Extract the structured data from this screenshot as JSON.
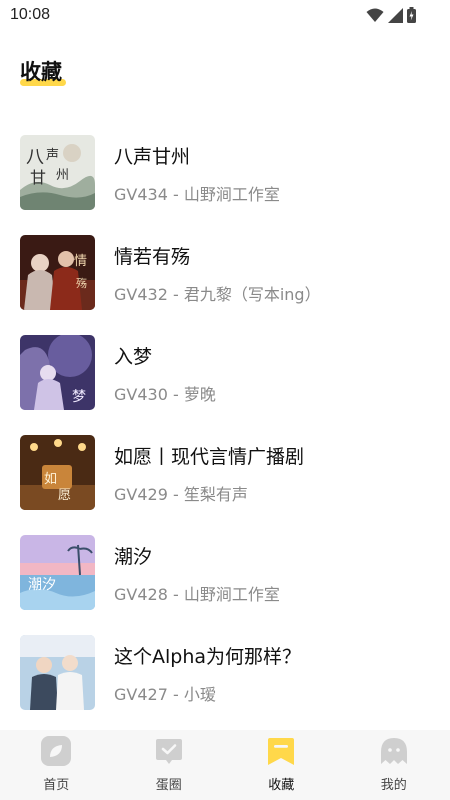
{
  "status_bar": {
    "time": "10:08"
  },
  "page_title": "收藏",
  "favorites": [
    {
      "title": "八声甘州",
      "subtitle": "GV434 - 山野涧工作室",
      "cover_icon": "cover-bashengganzhou"
    },
    {
      "title": "情若有殇",
      "subtitle": "GV432 - 君九黎（写本ing）",
      "cover_icon": "cover-qingruoyoushang"
    },
    {
      "title": "入梦",
      "subtitle": "GV430 - 萝晚",
      "cover_icon": "cover-rumeng"
    },
    {
      "title": "如愿丨现代言情广播剧",
      "subtitle": "GV429 - 笙梨有声",
      "cover_icon": "cover-ruyuan"
    },
    {
      "title": "潮汐",
      "subtitle": "GV428 - 山野涧工作室",
      "cover_icon": "cover-chaoxi"
    },
    {
      "title": "这个Alpha为何那样？",
      "subtitle": "GV427 - 小瑷",
      "cover_icon": "cover-alpha"
    }
  ],
  "tabbar": {
    "items": [
      {
        "label": "首页",
        "icon": "leaf-icon"
      },
      {
        "label": "蛋圈",
        "icon": "chat-check-icon"
      },
      {
        "label": "收藏",
        "icon": "bookmark-icon",
        "active": true
      },
      {
        "label": "我的",
        "icon": "ghost-icon"
      }
    ],
    "accent": "#ffd84a",
    "inactive_icon_color": "#cfcfcf"
  }
}
